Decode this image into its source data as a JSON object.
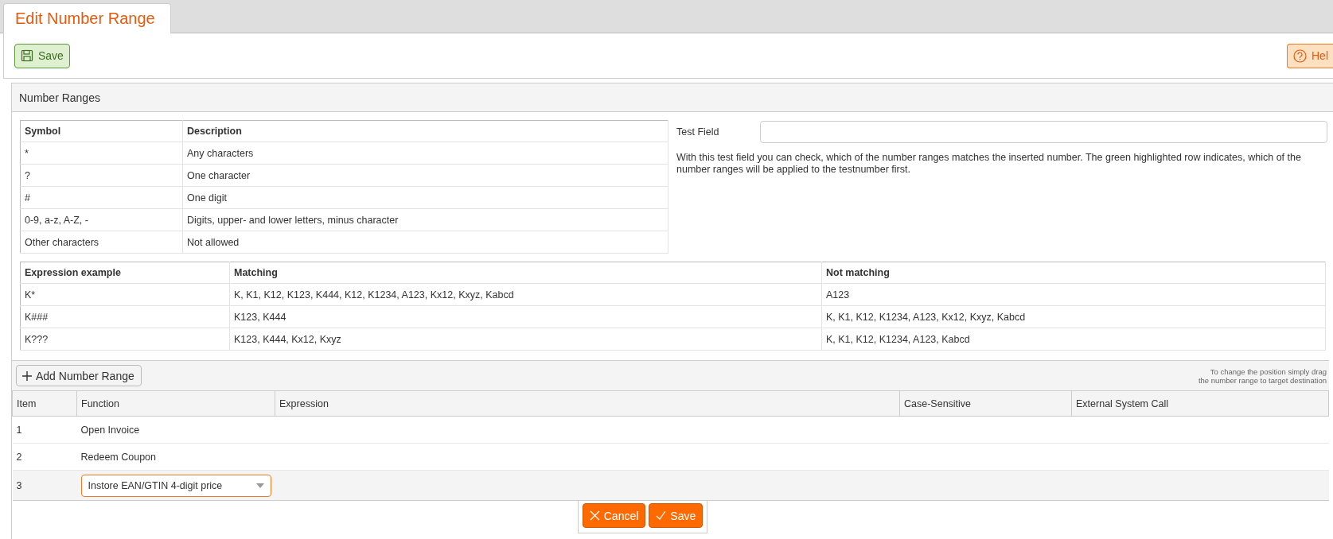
{
  "tab": {
    "label": "Edit Number Range"
  },
  "toolbar": {
    "save": "Save",
    "help": "Hel"
  },
  "panel": {
    "title": "Number Ranges",
    "symbol_table": {
      "columns": [
        "Symbol",
        "Description"
      ],
      "rows": [
        [
          "*",
          "Any characters"
        ],
        [
          "?",
          "One character"
        ],
        [
          "#",
          "One digit"
        ],
        [
          "0-9, a-z, A-Z, -",
          "Digits, upper- and lower letters, minus character"
        ],
        [
          "Other characters",
          "Not allowed"
        ]
      ]
    },
    "test_field": {
      "label": "Test Field"
    },
    "test_hint": "With this test field you can check, which of the number ranges matches the inserted number. The green highlighted row indicates, which of the number ranges will be applied to the testnumber first.",
    "example_table": {
      "columns": [
        "Expression example",
        "Matching",
        "Not matching"
      ],
      "rows": [
        [
          "K*",
          "K, K1, K12, K123, K444, K12, K1234, A123, Kx12, Kxyz, Kabcd",
          "A123"
        ],
        [
          "K###",
          "K123, K444",
          "K, K1, K12, K1234, A123, Kx12, Kxyz, Kabcd"
        ],
        [
          "K???",
          "K123, K444, Kx12, Kxyz",
          "K, K1, K12, K1234, A123, Kabcd"
        ]
      ]
    },
    "add_button": "Add Number Range",
    "drag_hint": "To change the position simply drag\nthe number range to target destination",
    "grid": {
      "columns": [
        "Item",
        "Function",
        "Expression",
        "Case-Sensitive",
        "External System Call"
      ],
      "rows": [
        {
          "kind": "view",
          "item": "1",
          "function": "Open Invoice"
        },
        {
          "kind": "view",
          "item": "2",
          "function": "Redeem Coupon"
        },
        {
          "kind": "edit",
          "item": "3",
          "function": "Instore EAN/GTIN 4-digit price"
        }
      ]
    },
    "edit_buttons": {
      "cancel": "Cancel",
      "save": "Save"
    }
  }
}
